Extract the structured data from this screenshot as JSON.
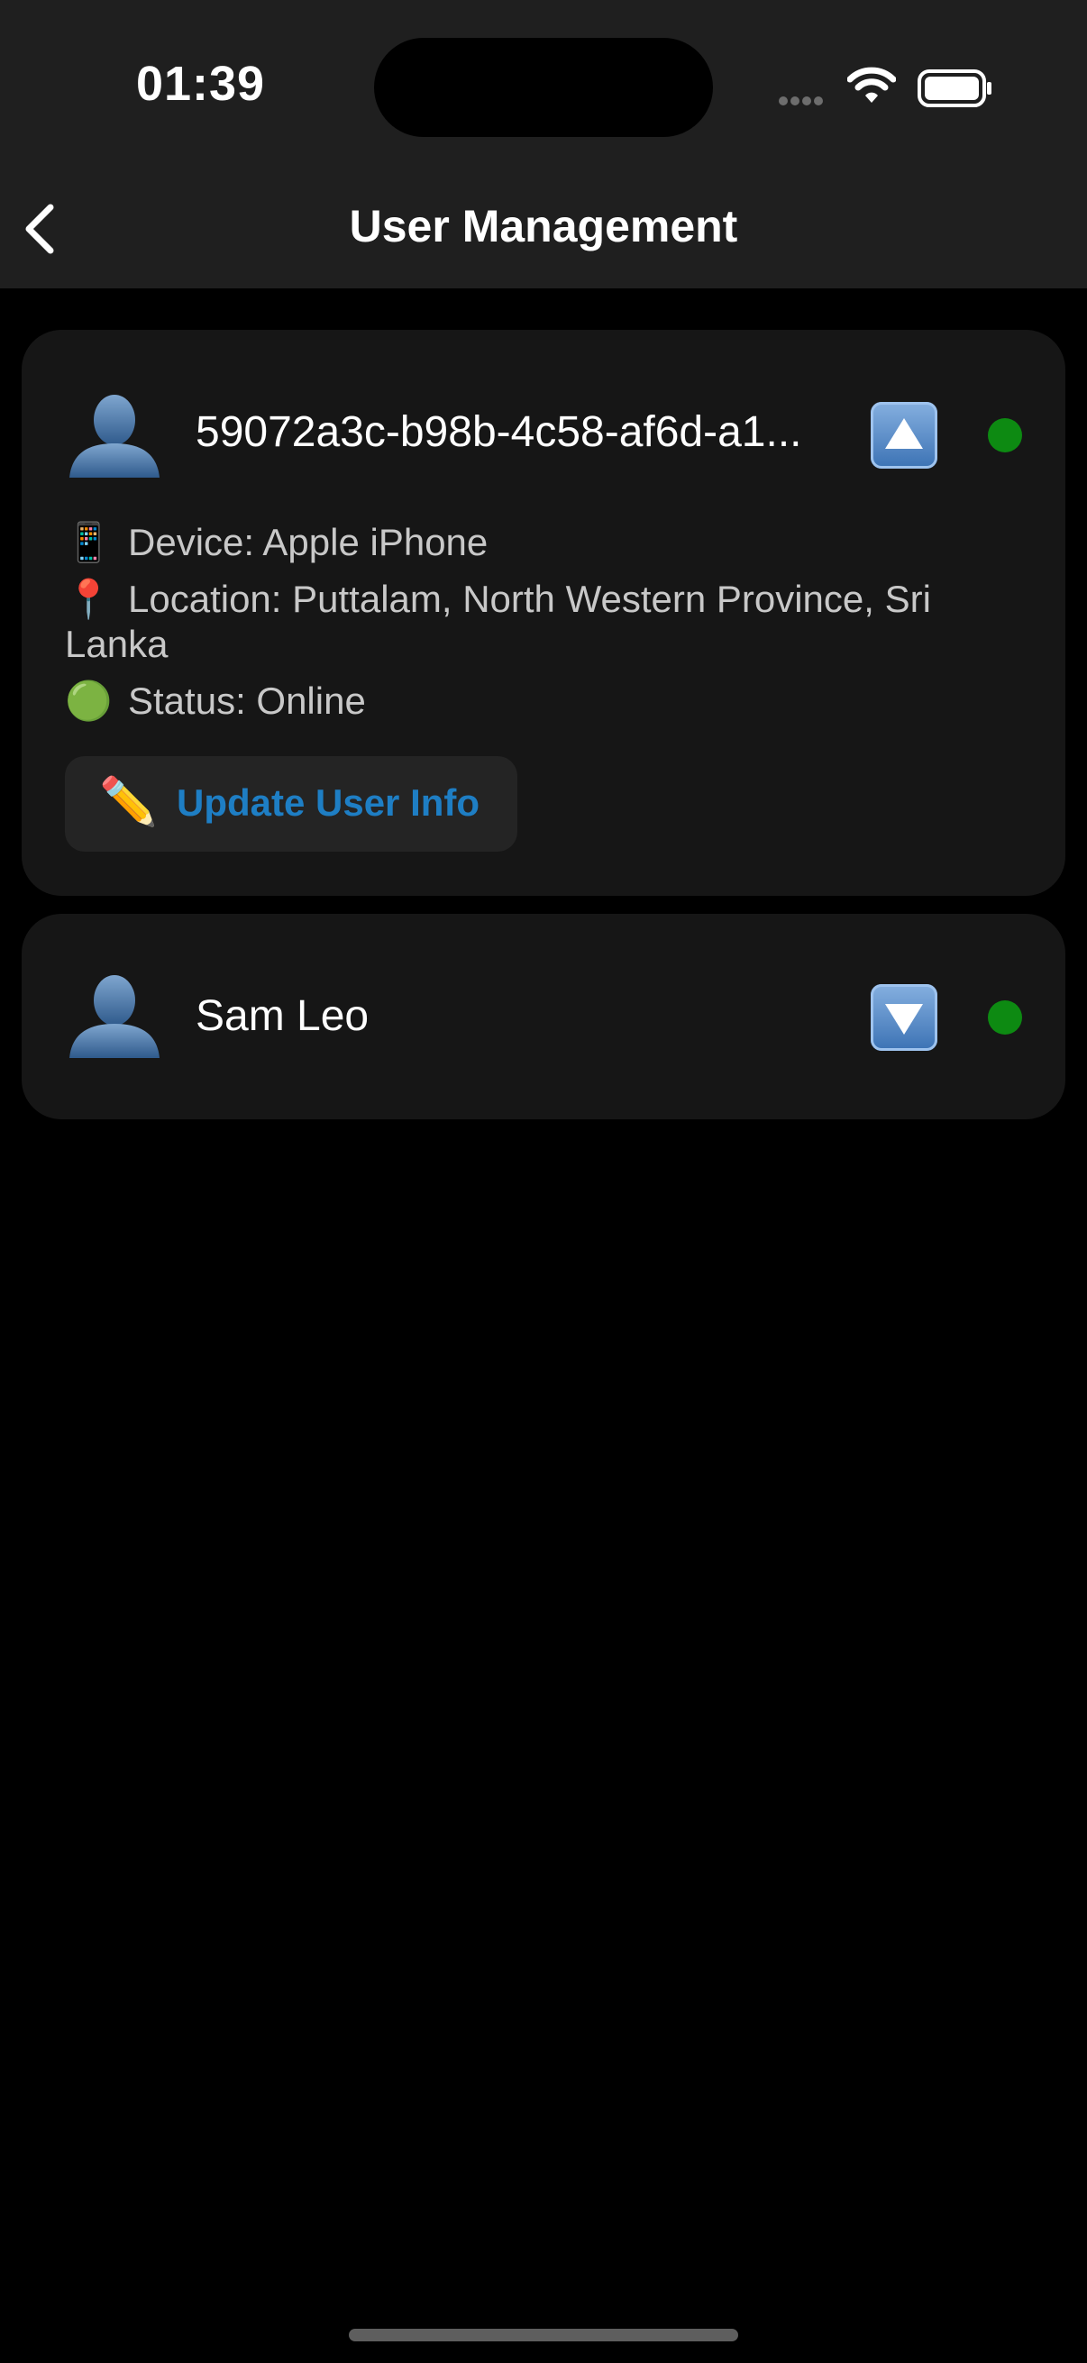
{
  "status_bar": {
    "time": "01:39",
    "signal_icon": "cellular-dots-icon",
    "wifi_icon": "wifi-icon",
    "battery_icon": "battery-full-icon"
  },
  "nav": {
    "back_icon": "chevron-left-icon",
    "title": "User Management"
  },
  "users": [
    {
      "name": "59072a3c-b98b-4c58-af6d-a1...",
      "avatar_icon": "user-silhouette-icon",
      "toggle_icon": "up-arrow-button-icon",
      "expanded": true,
      "online": true,
      "online_color": "#0d8a12",
      "details": {
        "device_emoji": "📱",
        "device": "Device: Apple iPhone",
        "location_emoji": "📍",
        "location": "Location: Puttalam, North Western Province, Sri Lanka",
        "status_emoji": "🟢",
        "status": "Status: Online"
      },
      "update_button": {
        "emoji": "✏️",
        "label": "Update User Info",
        "color": "#1e7ec4"
      }
    },
    {
      "name": "Sam Leo",
      "avatar_icon": "user-silhouette-icon",
      "toggle_icon": "down-arrow-button-icon",
      "expanded": false,
      "online": true,
      "online_color": "#0d8a12"
    }
  ]
}
